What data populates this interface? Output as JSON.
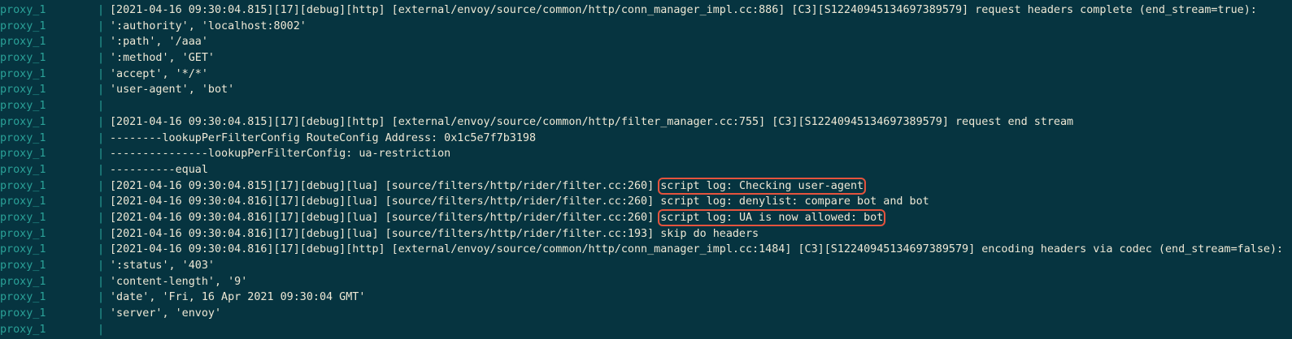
{
  "terminal": {
    "accent_color": "#2aa198",
    "highlight_color": "#e5533d",
    "separator": "|",
    "lines": [
      {
        "service": "proxy_1",
        "text": "[2021-04-16 09:30:04.815][17][debug][http] [external/envoy/source/common/http/conn_manager_impl.cc:886] [C3][S12240945134697389579] request headers complete (end_stream=true):",
        "highlight": ""
      },
      {
        "service": "proxy_1",
        "text": "':authority', 'localhost:8002'",
        "highlight": ""
      },
      {
        "service": "proxy_1",
        "text": "':path', '/aaa'",
        "highlight": ""
      },
      {
        "service": "proxy_1",
        "text": "':method', 'GET'",
        "highlight": ""
      },
      {
        "service": "proxy_1",
        "text": "'accept', '*/*'",
        "highlight": ""
      },
      {
        "service": "proxy_1",
        "text": "'user-agent', 'bot'",
        "highlight": ""
      },
      {
        "service": "proxy_1",
        "text": "",
        "highlight": ""
      },
      {
        "service": "proxy_1",
        "text": "[2021-04-16 09:30:04.815][17][debug][http] [external/envoy/source/common/http/filter_manager.cc:755] [C3][S12240945134697389579] request end stream",
        "highlight": ""
      },
      {
        "service": "proxy_1",
        "text": "--------lookupPerFilterConfig RouteConfig Address: 0x1c5e7f7b3198",
        "highlight": ""
      },
      {
        "service": "proxy_1",
        "text": "---------------lookupPerFilterConfig: ua-restriction",
        "highlight": ""
      },
      {
        "service": "proxy_1",
        "text": "----------equal",
        "highlight": ""
      },
      {
        "service": "proxy_1",
        "text": "[2021-04-16 09:30:04.815][17][debug][lua] [source/filters/http/rider/filter.cc:260] ",
        "highlight": "script log: Checking user-agent"
      },
      {
        "service": "proxy_1",
        "text": "[2021-04-16 09:30:04.816][17][debug][lua] [source/filters/http/rider/filter.cc:260] script log: denylist: compare bot and bot",
        "highlight": ""
      },
      {
        "service": "proxy_1",
        "text": "[2021-04-16 09:30:04.816][17][debug][lua] [source/filters/http/rider/filter.cc:260] ",
        "highlight": "script log: UA is now allowed: bot"
      },
      {
        "service": "proxy_1",
        "text": "[2021-04-16 09:30:04.816][17][debug][lua] [source/filters/http/rider/filter.cc:193] skip do headers",
        "highlight": ""
      },
      {
        "service": "proxy_1",
        "text": "[2021-04-16 09:30:04.816][17][debug][http] [external/envoy/source/common/http/conn_manager_impl.cc:1484] [C3][S12240945134697389579] encoding headers via codec (end_stream=false):",
        "highlight": ""
      },
      {
        "service": "proxy_1",
        "text": "':status', '403'",
        "highlight": ""
      },
      {
        "service": "proxy_1",
        "text": "'content-length', '9'",
        "highlight": ""
      },
      {
        "service": "proxy_1",
        "text": "'date', 'Fri, 16 Apr 2021 09:30:04 GMT'",
        "highlight": ""
      },
      {
        "service": "proxy_1",
        "text": "'server', 'envoy'",
        "highlight": ""
      },
      {
        "service": "proxy_1",
        "text": "",
        "highlight": ""
      }
    ]
  }
}
